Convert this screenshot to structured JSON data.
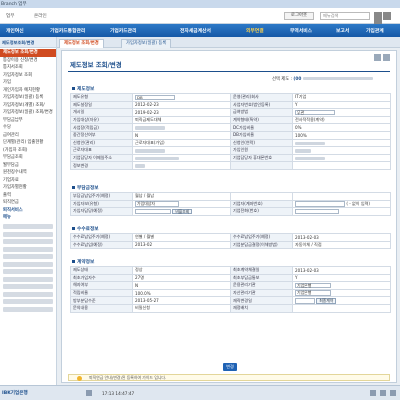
{
  "window": {
    "title": "Branch 업무"
  },
  "topbar": {
    "tab1": "업무",
    "tab2": "온라인",
    "logout": "로그아웃",
    "search_placeholder": "메뉴검색"
  },
  "mainnav": [
    "개인여신",
    "기업카드통합관리",
    "기업카드관리",
    "전자세금계산서",
    "외부연결",
    "무역서비스",
    "보고서",
    "가입관계"
  ],
  "sidebar": {
    "head_a": "제도정보조회/변경",
    "head_b": "비메뉴",
    "items": [
      "제도정보 조회/변경",
      "통장이용 신청/변경",
      "통지서조회",
      "가입자정보 조회",
      "가입",
      "개인가입자 예치현황",
      "가입자정보(일괄) 등록",
      "가입자정보(개별) 조회/",
      "가입자정보(일괄) 조회/변경",
      "부담금납부",
      "수당",
      "급여관리",
      "단계별(관리) 입출현황",
      "(가입자 조회)",
      "부담금조회",
      "월부담금",
      "원천징수내역",
      "기업자료",
      "가입자별현황",
      "출력",
      "퇴직연금"
    ],
    "section": "퇴직서비스",
    "section2": "메뉴"
  },
  "tabs": {
    "active": "제도정보 조회/변경",
    "second": "가입자정보(일괄) 등록"
  },
  "page": {
    "title": "제도정보 조회/변경",
    "select_label": "선택 제도 :",
    "select_value": "(00",
    "section1": "제도정보",
    "section2": "부담금정보",
    "section3": "수수료정보",
    "section4": "계약정보",
    "confirm": "변경",
    "notice": "퇴직연금 안내(변경)된 등록하여 가이드 입니다."
  },
  "system_info": {
    "rows": [
      [
        "제도유형",
        "DB",
        "운영(관리)회사",
        "IT기업"
      ],
      [
        "제도설정일",
        "2012-02-23",
        "사업자번호(법인등록)",
        "Y"
      ],
      [
        "개시일",
        "2019-02-23",
        "급여방법",
        "무관"
      ],
      [
        "가입대상(자유)",
        "퇴직금제도대체",
        "계약형태(특약)",
        "전사적적용(계약)"
      ],
      [
        "사업장(적립금)",
        "",
        "DC가입비율",
        "0%"
      ],
      [
        "중간정산여부",
        "N",
        "DB가입비율",
        "100%"
      ],
      [
        "신청인(관리)",
        "근로자대표(가입)",
        "신청인(연락)",
        ""
      ],
      [
        "근로자대표",
        "",
        "가입인원",
        ""
      ],
      [
        "기업담당자 이메일주소",
        "",
        "기업담당자 휴대폰번호",
        ""
      ],
      [
        "정보변경",
        "",
        "",
        ""
      ]
    ]
  },
  "burden_info": {
    "rows": [
      [
        "부담금납입주기(예정)",
        "월납 / 월납"
      ],
      [
        "가입자보(유형)",
        "가입대상자"
      ],
      [
        "가입자담당(예정)",
        "비율조회"
      ]
    ],
    "right_label1": "기업자(계좌번호)",
    "right_label2": "기업전화(번호)",
    "right_note": "( - 없이 입력)"
  },
  "fee_info": {
    "rows": [
      [
        "수수료납입주기(예정)",
        "연별 / 월별",
        "수수료납입주기(예정)",
        "2013-02-03"
      ],
      [
        "수수료납입(예정)",
        "2013-02",
        "기업분담금결정(이체방법)",
        "자동이체 / 직접"
      ]
    ]
  },
  "contract_info": {
    "rows": [
      [
        "제도상태",
        "정상",
        "최초계약체결일",
        "2013-02-03"
      ],
      [
        "최초가입자수",
        "27명",
        "최초부담금통보",
        "Y"
      ],
      [
        "해지여부",
        "N",
        "운용관리기관",
        "기업은행"
      ],
      [
        "적립비율",
        "100.0%",
        "자산관리기관",
        "기업은행"
      ],
      [
        "방부분담수준",
        "2013-05-27",
        "재직변경일",
        "최종계약"
      ],
      [
        "문의내용",
        "비밀신청",
        "재정배치",
        ""
      ]
    ]
  },
  "statusbar": {
    "logo": "IBK기업은행",
    "time": "17:13 14:47:47"
  },
  "colors": {
    "primary": "#1d4f8c",
    "accent": "#d04b20",
    "nav": "#1658a6"
  }
}
